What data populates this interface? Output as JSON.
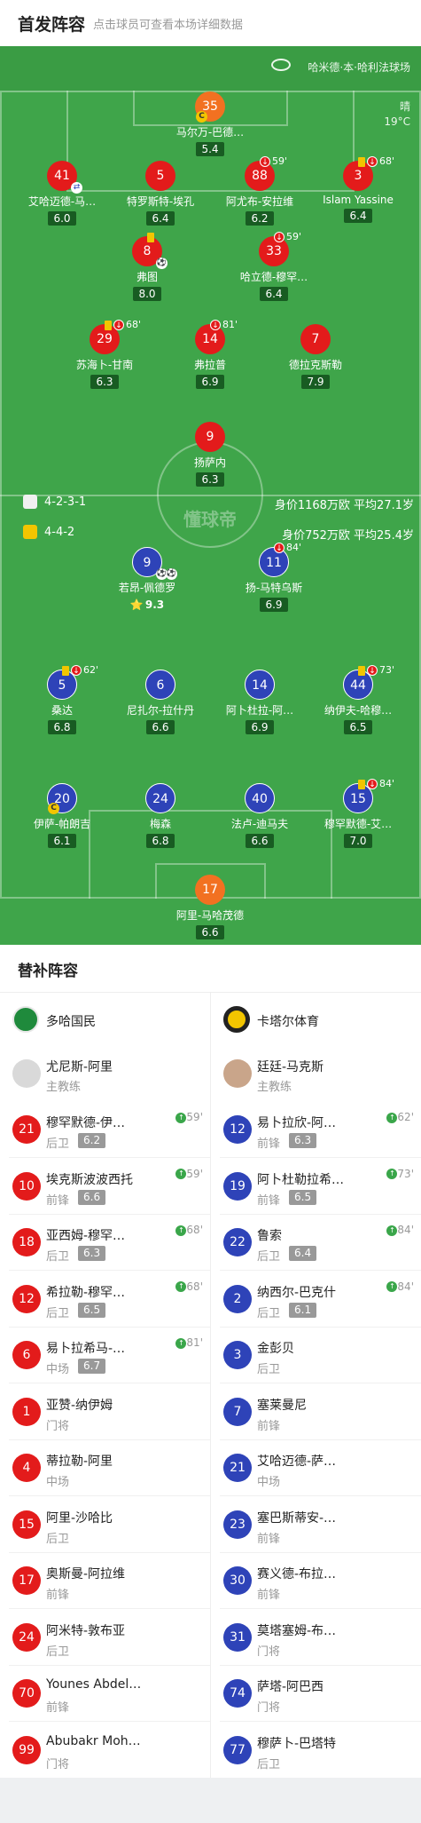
{
  "header": {
    "title": "首发阵容",
    "subtitle": "点击球员可查看本场详细数据"
  },
  "venue": "哈米德·本·哈利法球场",
  "weather": {
    "condition": "晴",
    "temperature": "19°C"
  },
  "watermark": "懂球帝",
  "home_team": {
    "name": "多哈国民",
    "formation": "4-2-3-1",
    "value_age": "身价1168万欧  平均27.1岁",
    "color": "#e31b1b"
  },
  "away_team": {
    "name": "卡塔尔体育",
    "formation": "4-4-2",
    "value_age": "身价752万欧  平均25.4岁",
    "color": "#2e43b8"
  },
  "home_players": [
    {
      "num": "35",
      "name": "马尔万-巴德…",
      "rating": "5.4",
      "captain": true
    },
    {
      "num": "41",
      "name": "艾哈迈德-马…",
      "rating": "6.0",
      "sub_out": true
    },
    {
      "num": "5",
      "name": "特罗斯特-埃孔",
      "rating": "6.4"
    },
    {
      "num": "88",
      "name": "阿尤布-安拉维",
      "rating": "6.2",
      "event": "59'"
    },
    {
      "num": "3",
      "name": "Islam Yassine",
      "rating": "6.4",
      "event": "68'",
      "yellow": true
    },
    {
      "num": "8",
      "name": "弗图",
      "rating": "8.0",
      "yellow": true,
      "goal": true
    },
    {
      "num": "33",
      "name": "哈立德-穆罕…",
      "rating": "6.4",
      "event": "59'"
    },
    {
      "num": "29",
      "name": "苏海卜-甘南",
      "rating": "6.3",
      "event": "68'",
      "yellow": true
    },
    {
      "num": "14",
      "name": "弗拉普",
      "rating": "6.9",
      "event": "81'"
    },
    {
      "num": "7",
      "name": "德拉克斯勒",
      "rating": "7.9"
    },
    {
      "num": "9",
      "name": "扬萨内",
      "rating": "6.3"
    }
  ],
  "away_players": [
    {
      "num": "9",
      "name": "若昂-佩德罗",
      "rating": "9.3",
      "goals": 2
    },
    {
      "num": "11",
      "name": "扬-马特乌斯",
      "rating": "6.9",
      "event": "84'"
    },
    {
      "num": "5",
      "name": "桑达",
      "rating": "6.8",
      "event": "62'",
      "yellow": true
    },
    {
      "num": "6",
      "name": "尼扎尔-拉什丹",
      "rating": "6.6"
    },
    {
      "num": "14",
      "name": "阿卜杜拉-阿…",
      "rating": "6.9"
    },
    {
      "num": "44",
      "name": "纳伊夫-哈穆…",
      "rating": "6.5",
      "event": "73'",
      "yellow": true
    },
    {
      "num": "20",
      "name": "伊萨-帕朗吉",
      "rating": "6.1",
      "captain": true
    },
    {
      "num": "24",
      "name": "梅森",
      "rating": "6.8"
    },
    {
      "num": "40",
      "name": "法卢-迪马夫",
      "rating": "6.6"
    },
    {
      "num": "15",
      "name": "穆罕默德-艾…",
      "rating": "7.0",
      "event": "84'",
      "yellow": true
    },
    {
      "num": "17",
      "name": "阿里-马哈茂德",
      "rating": "6.6",
      "gk": true
    }
  ],
  "subs": {
    "title": "替补阵容",
    "home_coach": {
      "name": "尤尼斯-阿里",
      "role": "主教练"
    },
    "away_coach": {
      "name": "廷廷-马克斯",
      "role": "主教练"
    },
    "home": [
      {
        "num": "21",
        "name": "穆罕默德-伊…",
        "pos": "后卫",
        "rating": "6.2",
        "minute": "59'"
      },
      {
        "num": "10",
        "name": "埃克斯波波西托",
        "pos": "前锋",
        "rating": "6.6",
        "minute": "59'"
      },
      {
        "num": "18",
        "name": "亚西姆-穆罕…",
        "pos": "后卫",
        "rating": "6.3",
        "minute": "68'"
      },
      {
        "num": "12",
        "name": "希拉勒-穆罕…",
        "pos": "后卫",
        "rating": "6.5",
        "minute": "68'"
      },
      {
        "num": "6",
        "name": "易卜拉希马-…",
        "pos": "中场",
        "rating": "6.7",
        "minute": "81'"
      },
      {
        "num": "1",
        "name": "亚赞-纳伊姆",
        "pos": "门将"
      },
      {
        "num": "4",
        "name": "蒂拉勒-阿里",
        "pos": "中场"
      },
      {
        "num": "15",
        "name": "阿里-沙哈比",
        "pos": "后卫"
      },
      {
        "num": "17",
        "name": "奥斯曼-阿拉维",
        "pos": "前锋"
      },
      {
        "num": "24",
        "name": "阿米特-敦布亚",
        "pos": "后卫"
      },
      {
        "num": "70",
        "name": "Younes Abdel…",
        "pos": "前锋"
      },
      {
        "num": "99",
        "name": "Abubakr Moh…",
        "pos": "门将"
      }
    ],
    "away": [
      {
        "num": "12",
        "name": "易卜拉欣-阿…",
        "pos": "前锋",
        "rating": "6.3",
        "minute": "62'"
      },
      {
        "num": "19",
        "name": "阿卜杜勒拉希…",
        "pos": "前锋",
        "rating": "6.5",
        "minute": "73'"
      },
      {
        "num": "22",
        "name": "鲁索",
        "pos": "后卫",
        "rating": "6.4",
        "minute": "84'"
      },
      {
        "num": "2",
        "name": "纳西尔-巴克什",
        "pos": "后卫",
        "rating": "6.1",
        "minute": "84'"
      },
      {
        "num": "3",
        "name": "金彭贝",
        "pos": "后卫"
      },
      {
        "num": "7",
        "name": "塞莱曼尼",
        "pos": "前锋"
      },
      {
        "num": "21",
        "name": "艾哈迈德-萨…",
        "pos": "中场"
      },
      {
        "num": "23",
        "name": "塞巴斯蒂安-…",
        "pos": "前锋"
      },
      {
        "num": "30",
        "name": "赛义德-布拉…",
        "pos": "前锋"
      },
      {
        "num": "31",
        "name": "莫塔塞姆-布…",
        "pos": "门将"
      },
      {
        "num": "74",
        "name": "萨塔-阿巴西",
        "pos": "门将"
      },
      {
        "num": "77",
        "name": "穆萨卜-巴塔特",
        "pos": "后卫"
      }
    ]
  }
}
